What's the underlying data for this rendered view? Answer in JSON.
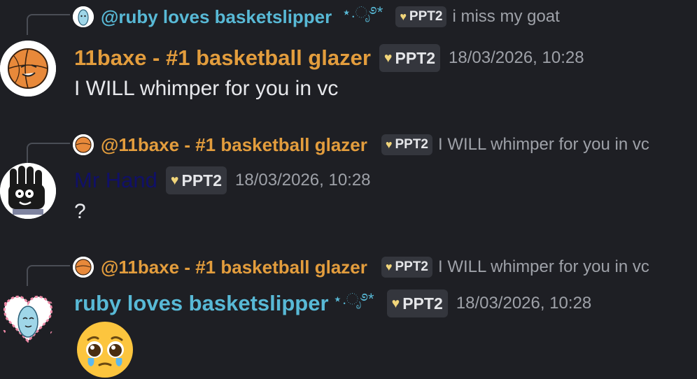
{
  "colors": {
    "background": "#1e1f24",
    "orange_name": "#e39d3d",
    "blue_name": "#58b9d6",
    "dark_name": "#101068",
    "muted_text": "#9ea1a8",
    "tag_bg": "#34363d"
  },
  "messages": [
    {
      "reply": {
        "name": "@ruby loves basketslipper",
        "decoration": "⋆.ೃ࿔*",
        "tag": "PPT2",
        "text": "i miss my goat"
      },
      "author": "11baxe - #1 basketball glazer",
      "tag": "PPT2",
      "timestamp": "18/03/2026, 10:28",
      "content": "I WILL whimper for you in vc"
    },
    {
      "reply": {
        "name": "@11baxe - #1 basketball glazer",
        "tag": "PPT2",
        "text": "I WILL whimper for you in vc"
      },
      "author": "Mr Hand",
      "tag": "PPT2",
      "timestamp": "18/03/2026, 10:28",
      "content": "?"
    },
    {
      "reply": {
        "name": "@11baxe - #1 basketball glazer",
        "tag": "PPT2",
        "text": "I WILL whimper for you in vc"
      },
      "author": "ruby loves basketslipper",
      "decoration": "⋆.ೃ࿔*",
      "tag": "PPT2",
      "timestamp": "18/03/2026, 10:28",
      "content_emoji": "pleading-face-emoji"
    }
  ]
}
